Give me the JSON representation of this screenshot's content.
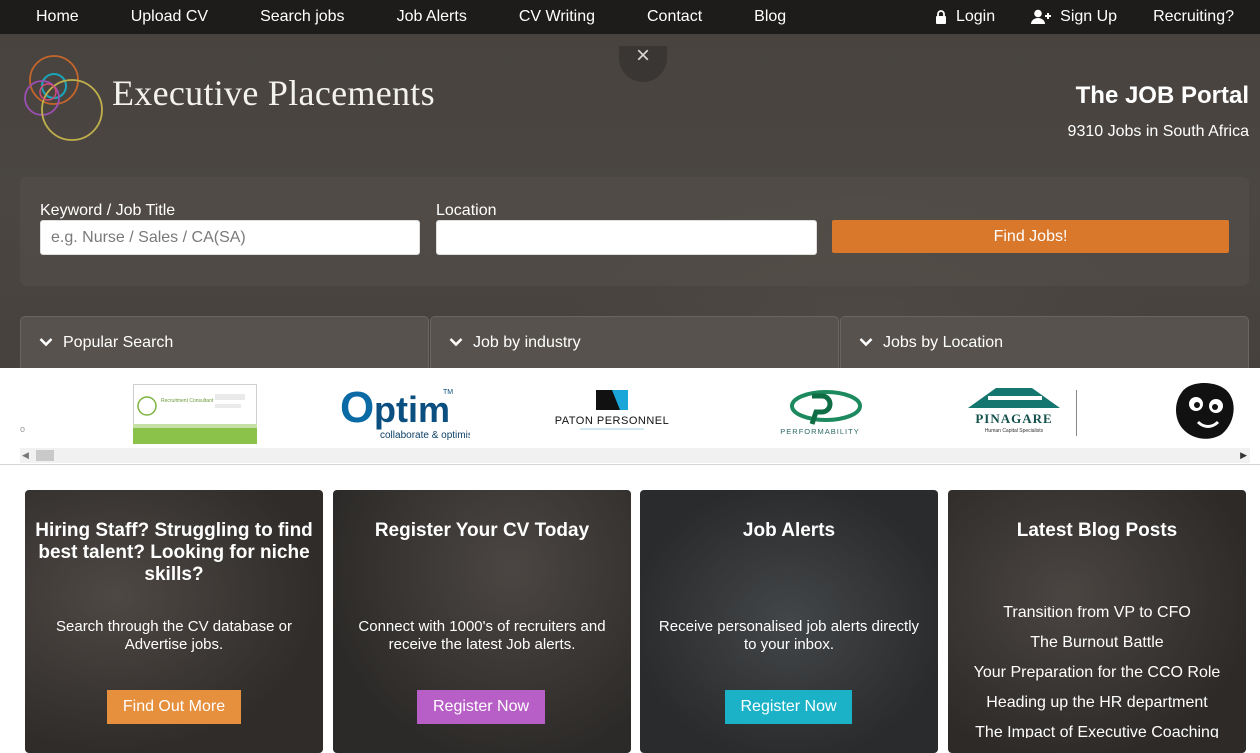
{
  "nav": {
    "left": [
      "Home",
      "Upload CV",
      "Search jobs",
      "Job Alerts",
      "CV Writing",
      "Contact",
      "Blog"
    ],
    "login": "Login",
    "signup": "Sign Up",
    "recruiting": "Recruiting?",
    "close": "×"
  },
  "hero": {
    "brand": "Executive Placements",
    "portal_title": "The JOB Portal",
    "portal_count": "9310 Jobs in South Africa"
  },
  "search": {
    "keyword_label": "Keyword / Job Title",
    "keyword_placeholder": "e.g. Nurse / Sales / CA(SA)",
    "location_label": "Location",
    "location_value": "",
    "button": "Find Jobs!"
  },
  "tabs": [
    "Popular Search",
    "Job by industry",
    "Jobs by Location"
  ],
  "logos": {
    "small_mark": "o",
    "items": [
      {
        "name": "Recruitment Consultant",
        "caption": "Recruitment Consultant"
      },
      {
        "name": "Optim",
        "word": "ptim",
        "tagline": "collaborate & optimise",
        "tm": "TM"
      },
      {
        "name": "Paton Personnel",
        "word": "PATON PERSONNEL"
      },
      {
        "name": "Performability",
        "word": "PERFORMABILITY"
      },
      {
        "name": "Pinagare",
        "word": "PINAGARE",
        "tagline": "Human Capital Specialists"
      },
      {
        "name": "Animal logo"
      }
    ]
  },
  "cards": [
    {
      "title": "Hiring Staff? Struggling to find best talent? Looking for niche skills?",
      "text": "Search through the CV database or Advertise jobs.",
      "button": "Find Out More"
    },
    {
      "title": "Register Your CV Today",
      "text": "Connect with 1000's of recruiters and receive the latest Job alerts.",
      "button": "Register Now"
    },
    {
      "title": "Job Alerts",
      "text": "Receive personalised job alerts directly to your inbox.",
      "button": "Register Now"
    },
    {
      "title": "Latest Blog Posts",
      "posts": [
        "Transition from VP to CFO",
        "The Burnout Battle",
        "Your Preparation for the CCO Role",
        "Heading up the HR department",
        "The Impact of Executive Coaching"
      ]
    }
  ],
  "colors": {
    "nav_bg": "#1d1c1b",
    "find_button": "#d9782b",
    "btn_orange": "#e68f3d",
    "btn_purple": "#b85fc7",
    "btn_teal": "#1bb2c8"
  }
}
